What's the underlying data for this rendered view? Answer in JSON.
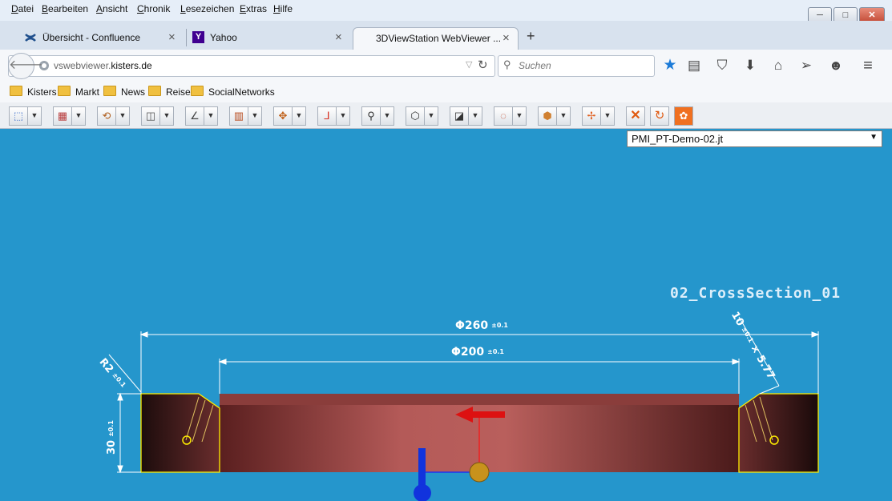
{
  "menubar": {
    "items": [
      "Datei",
      "Bearbeiten",
      "Ansicht",
      "Chronik",
      "Lesezeichen",
      "Extras",
      "Hilfe"
    ],
    "underline": [
      "D",
      "B",
      "A",
      "C",
      "L",
      "E",
      "H"
    ]
  },
  "window_controls": {
    "minimize": "─",
    "maximize": "□",
    "close": "✕"
  },
  "tabs": [
    {
      "label": "Übersicht - Confluence",
      "icon": "confluence-icon"
    },
    {
      "label": "Yahoo",
      "icon": "yahoo-icon"
    },
    {
      "label": "3DViewStation WebViewer ...",
      "icon": ""
    }
  ],
  "new_tab": "+",
  "url": {
    "prefix": "vswebviewer.",
    "domain": "kisters.de"
  },
  "search": {
    "placeholder": "Suchen"
  },
  "bookmarks": [
    "Kisters",
    "Markt",
    "News",
    "Reise",
    "SocialNetworks"
  ],
  "viewer": {
    "file_select": "PMI_PT-Demo-02.jt",
    "section_title": "02_CrossSection_01",
    "dimensions": {
      "outer_diameter": "Φ260",
      "outer_tol": "±0.1",
      "inner_diameter": "Φ200",
      "inner_tol": "±0.1",
      "radius": "R2",
      "radius_tol": "±0.1",
      "chamfer": "10",
      "chamfer_tol": "±0.1",
      "chamfer_rest": "× 5.77",
      "height": "30",
      "height_tol": "±0.1"
    }
  },
  "colors": {
    "viewport_bg": "#2596cc",
    "part_body": "#a9504f",
    "pmi_text": "#ffffff",
    "section_outline": "#ffee00"
  }
}
